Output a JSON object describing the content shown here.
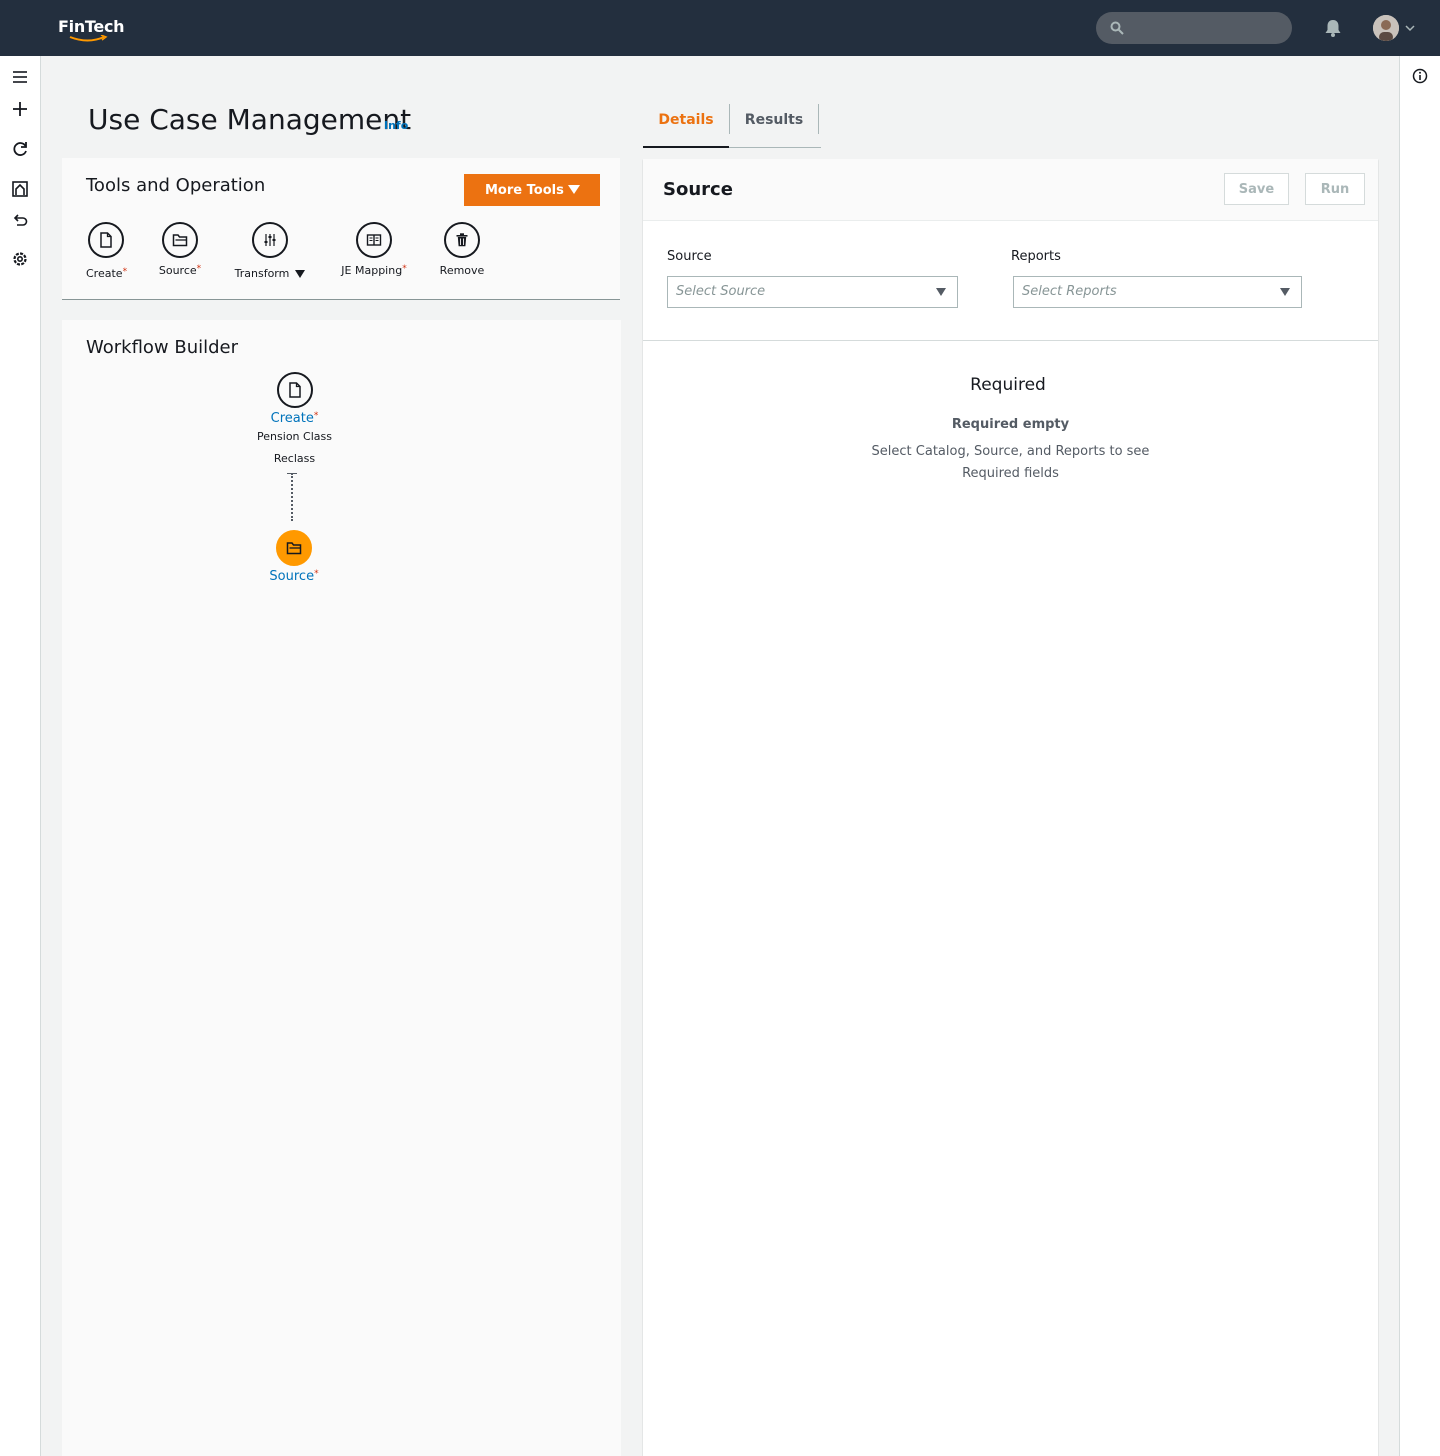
{
  "app": {
    "brand": "FinTech"
  },
  "page": {
    "title": "Use Case Management",
    "info_link": "Info"
  },
  "tools": {
    "title": "Tools and Operation",
    "more_tools_label": "More Tools",
    "items": [
      {
        "label": "Create",
        "required": "*",
        "icon": "file-icon"
      },
      {
        "label": "Source",
        "required": "*",
        "icon": "folder-icon"
      },
      {
        "label": "Transform",
        "required": "",
        "icon": "sliders-icon"
      },
      {
        "label": "JE Mapping",
        "required": "*",
        "icon": "book-icon"
      },
      {
        "label": "Remove",
        "required": "",
        "icon": "trash-icon"
      }
    ]
  },
  "workflow": {
    "title": "Workflow Builder",
    "nodes": [
      {
        "label": "Create",
        "required": "*",
        "sub_line1": "Pension Class",
        "sub_line2": "Reclass"
      },
      {
        "label": "Source",
        "required": "*"
      }
    ]
  },
  "tabs": {
    "details": "Details",
    "results": "Results"
  },
  "detail_panel": {
    "title": "Source",
    "save_label": "Save",
    "run_label": "Run",
    "source_label": "Source",
    "source_placeholder": "Select Source",
    "reports_label": "Reports",
    "reports_placeholder": "Select Reports",
    "required_title": "Required",
    "required_empty": "Required empty",
    "required_desc_line1": "Select Catalog, Source, and Reports to see",
    "required_desc_line2": "Required fields"
  },
  "colors": {
    "accent": "#ec7211",
    "link": "#0073bb",
    "active_node": "#ff9900",
    "topbar": "#232f3e"
  }
}
